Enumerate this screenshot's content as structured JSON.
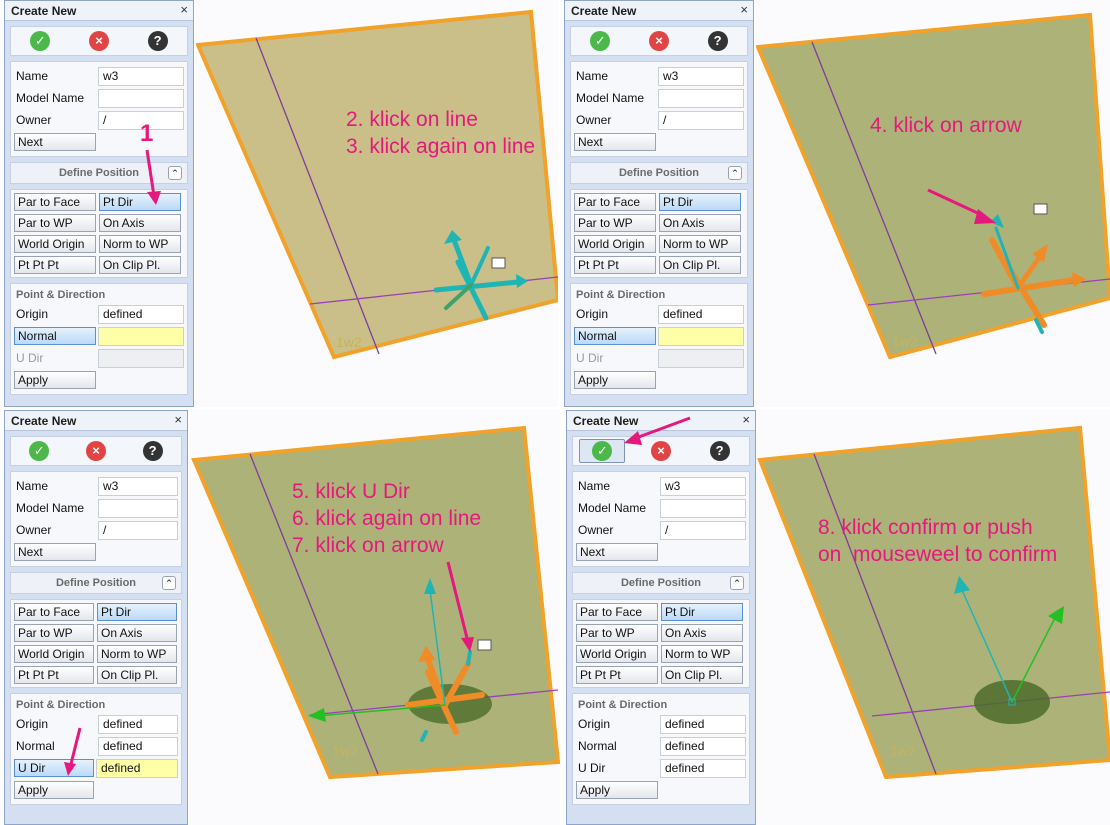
{
  "panel": {
    "title": "Create New",
    "close_glyph": "×",
    "icons": {
      "confirm": "check-icon",
      "cancel": "close-icon",
      "help": "help-icon"
    },
    "confirm_glyph": "✓",
    "cancel_glyph": "×",
    "help_glyph": "?",
    "name_label": "Name",
    "name_value": "w3",
    "model_label": "Model Name",
    "model_value": "",
    "owner_label": "Owner",
    "owner_value": "/",
    "next_label": "Next",
    "define_position": "Define Position",
    "collapse_glyph": "⌃",
    "buttons": [
      "Par to Face",
      "Pt Dir",
      "Par to WP",
      "On Axis",
      "World Origin",
      "Norm to WP",
      "Pt Pt Pt",
      "On Clip Pl."
    ],
    "point_direction": "Point & Direction",
    "origin_label": "Origin",
    "normal_label": "Normal",
    "udir_label": "U Dir",
    "apply_label": "Apply",
    "defined": "defined"
  },
  "plane_label": "1w2",
  "colors": {
    "annotation": "#e5197d",
    "plane": "#b6a658",
    "plane_edge": "#f0a22a",
    "axis_cyan": "#1fb5b5",
    "axis_orange": "#f08c28",
    "axis_green": "#22c022"
  },
  "annotations": {
    "q1_1": "1",
    "q1_2": "2. klick on line",
    "q1_3": "3. klick again on line",
    "q2_4": "4. klick on arrow",
    "q3_5": "5. klick U Dir",
    "q3_6": "6. klick again on line",
    "q3_7": "7. klick on arrow",
    "q4_8a": "8. klick confirm or push",
    "q4_8b": "on  mouseweel to confirm"
  }
}
